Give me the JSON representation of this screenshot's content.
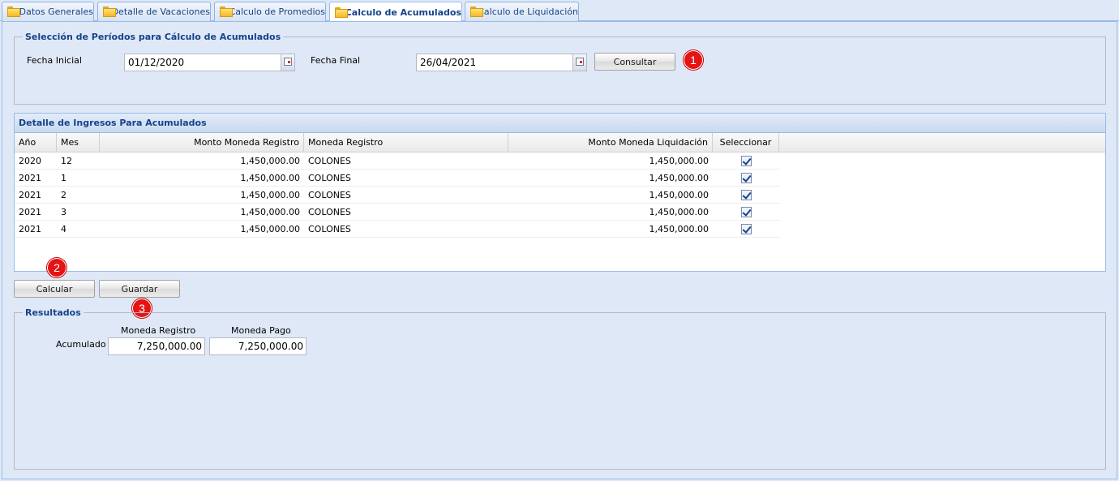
{
  "tabs": [
    {
      "label": "Datos Generales",
      "active": false
    },
    {
      "label": "Detalle de Vacaciones",
      "active": false
    },
    {
      "label": "Calculo de Promedios",
      "active": false
    },
    {
      "label": "Calculo de Acumulados",
      "active": true
    },
    {
      "label": "Calculo de Liquidación",
      "active": false
    }
  ],
  "periodo": {
    "legend": "Selección de Períodos para Cálculo de Acumulados",
    "fecha_inicial_label": "Fecha Inicial",
    "fecha_inicial_value": "01/12/2020",
    "fecha_final_label": "Fecha Final",
    "fecha_final_value": "26/04/2021",
    "consultar_label": "Consultar"
  },
  "badges": [
    "1",
    "2",
    "3"
  ],
  "grid": {
    "title": "Detalle de Ingresos Para Acumulados",
    "columns": [
      "Año",
      "Mes",
      "Monto Moneda Registro",
      "Moneda Registro",
      "Monto Moneda Liquidación",
      "Seleccionar"
    ],
    "rows": [
      {
        "anio": "2020",
        "mes": "12",
        "monto_registro": "1,450,000.00",
        "moneda": "COLONES",
        "monto_liquidacion": "1,450,000.00",
        "seleccionado": true
      },
      {
        "anio": "2021",
        "mes": "1",
        "monto_registro": "1,450,000.00",
        "moneda": "COLONES",
        "monto_liquidacion": "1,450,000.00",
        "seleccionado": true
      },
      {
        "anio": "2021",
        "mes": "2",
        "monto_registro": "1,450,000.00",
        "moneda": "COLONES",
        "monto_liquidacion": "1,450,000.00",
        "seleccionado": true
      },
      {
        "anio": "2021",
        "mes": "3",
        "monto_registro": "1,450,000.00",
        "moneda": "COLONES",
        "monto_liquidacion": "1,450,000.00",
        "seleccionado": true
      },
      {
        "anio": "2021",
        "mes": "4",
        "monto_registro": "1,450,000.00",
        "moneda": "COLONES",
        "monto_liquidacion": "1,450,000.00",
        "seleccionado": true
      }
    ]
  },
  "actions": {
    "calcular_label": "Calcular",
    "guardar_label": "Guardar"
  },
  "resultados": {
    "legend": "Resultados",
    "col_registro": "Moneda Registro",
    "col_pago": "Moneda Pago",
    "row_label": "Acumulado",
    "acumulado_registro": "7,250,000.00",
    "acumulado_pago": "7,250,000.00"
  },
  "colors": {
    "accent": "#15428b",
    "badge": "#e41414",
    "background": "#dfe8f6"
  }
}
